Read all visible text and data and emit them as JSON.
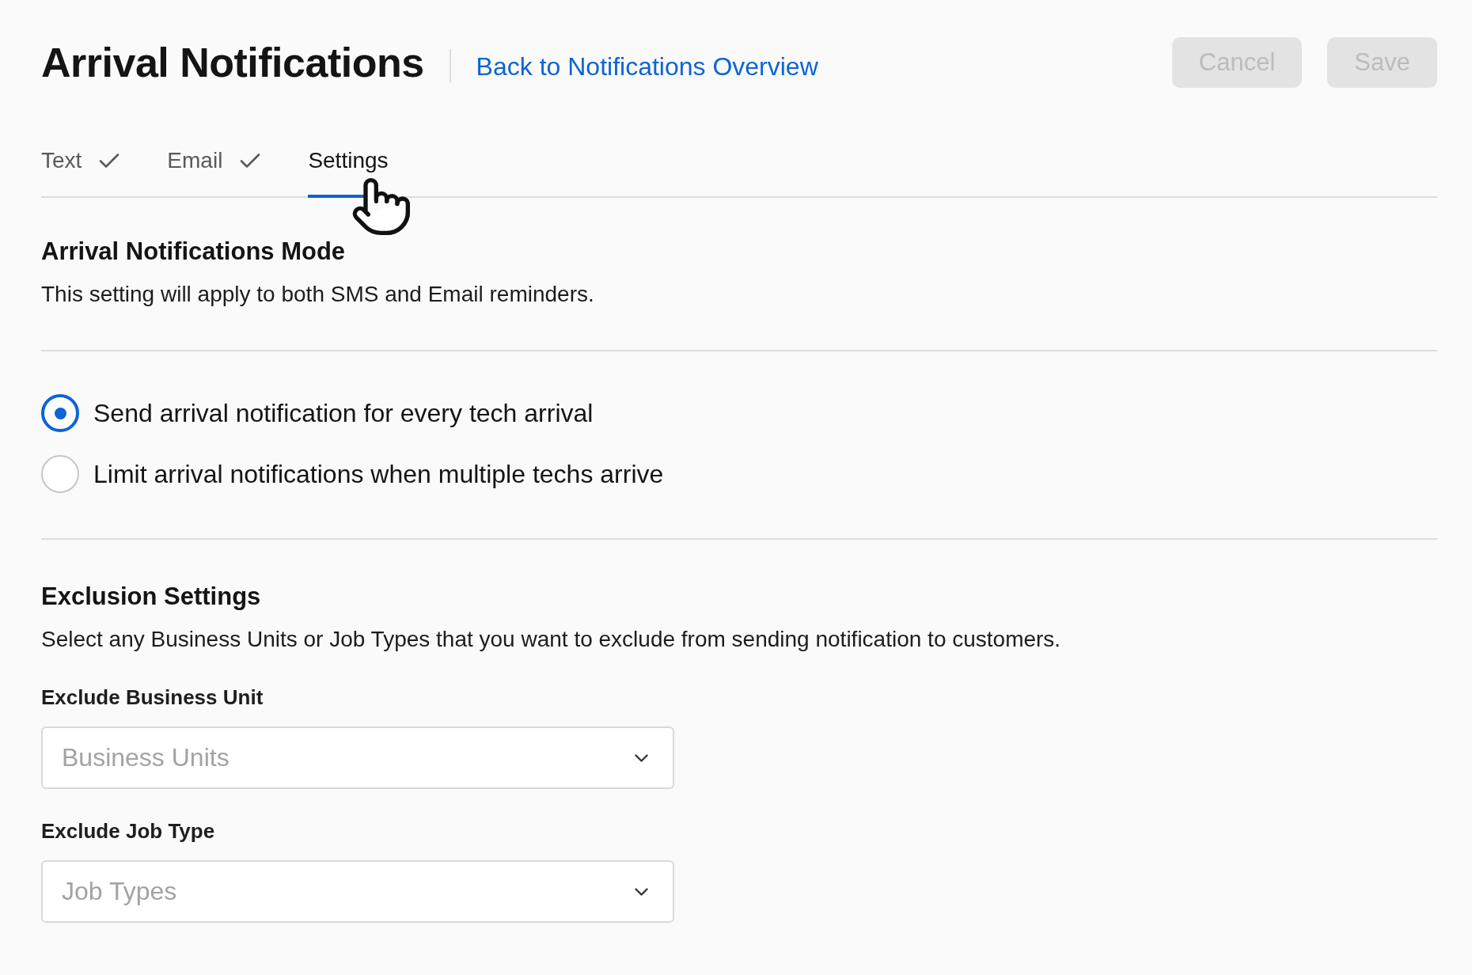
{
  "header": {
    "title": "Arrival Notifications",
    "back_link": "Back to Notifications Overview",
    "buttons": [
      {
        "label": "Cancel",
        "disabled": true
      },
      {
        "label": "Save",
        "disabled": true
      }
    ]
  },
  "tabs": [
    {
      "label": "Text",
      "completed": true,
      "selected": false
    },
    {
      "label": "Email",
      "completed": true,
      "selected": false
    },
    {
      "label": "Settings",
      "completed": false,
      "selected": true
    }
  ],
  "mode_section": {
    "title": "Arrival Notifications Mode",
    "description": "This setting will apply to both SMS and Email reminders.",
    "options": [
      {
        "label": "Send arrival notification for every tech arrival",
        "selected": true
      },
      {
        "label": "Limit arrival notifications when multiple techs arrive",
        "selected": false
      }
    ]
  },
  "exclusion_section": {
    "title": "Exclusion Settings",
    "description": "Select any Business Units or Job Types that you want to exclude from sending notification to customers.",
    "fields": [
      {
        "label": "Exclude Business Unit",
        "placeholder": "Business Units"
      },
      {
        "label": "Exclude Job Type",
        "placeholder": "Job Types"
      }
    ]
  }
}
